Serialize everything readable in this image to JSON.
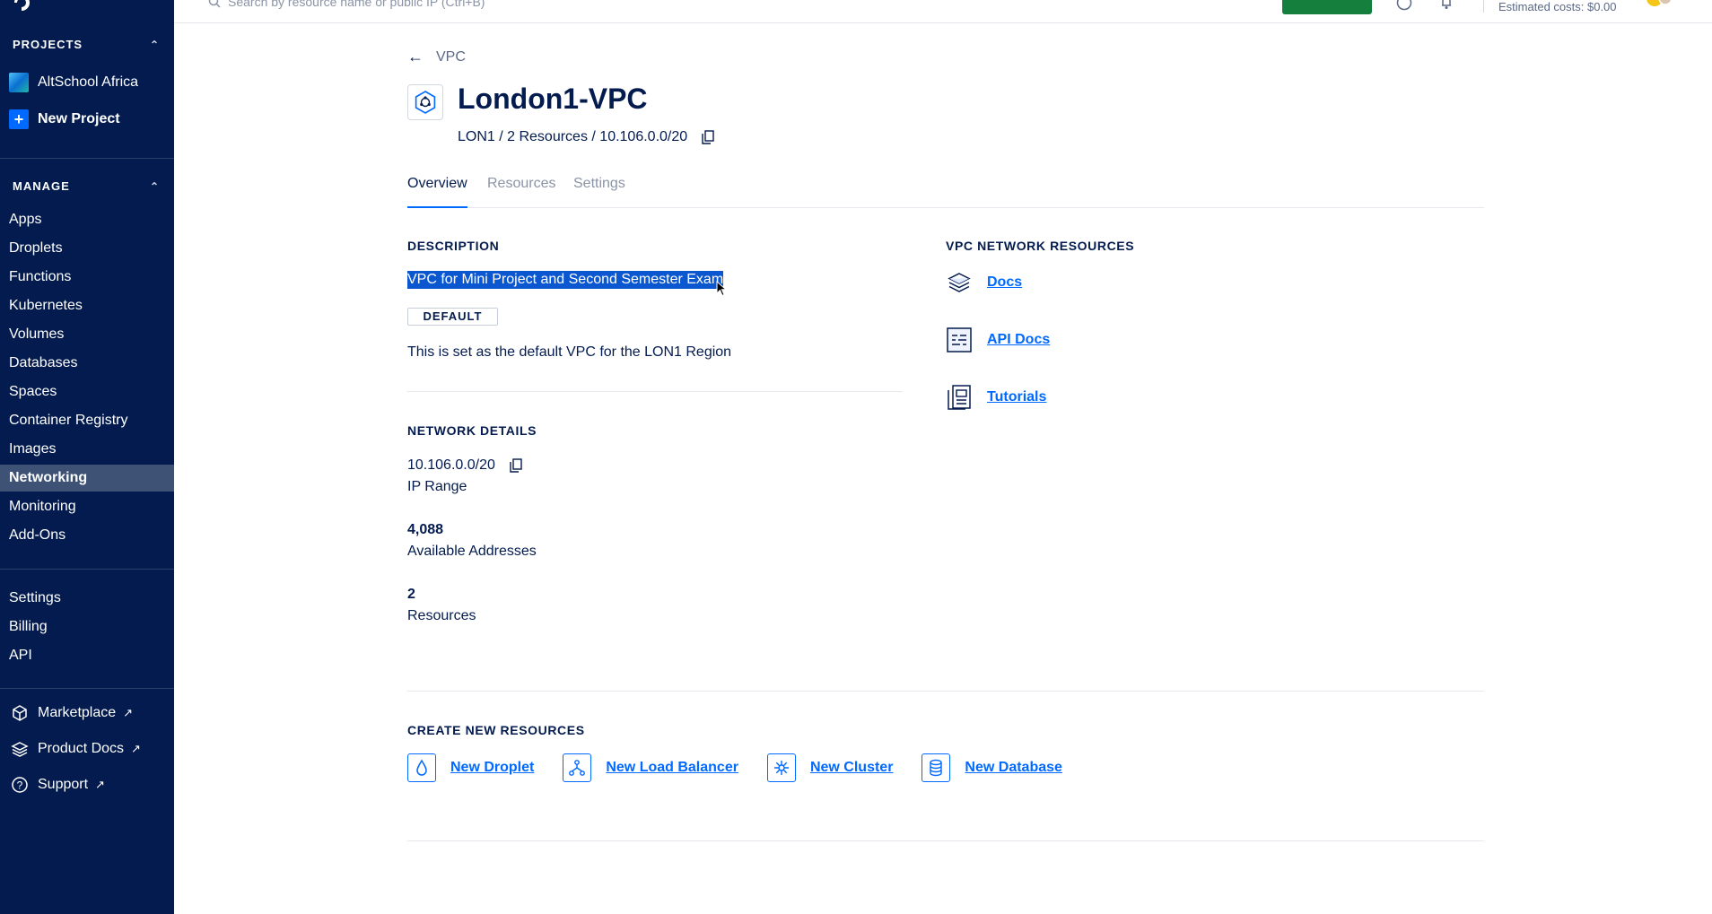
{
  "sidebar": {
    "projects_heading": "PROJECTS",
    "projects": [
      {
        "label": "AltSchool Africa",
        "icon": "project-icon"
      },
      {
        "label": "New Project",
        "icon": "plus-icon"
      }
    ],
    "manage_heading": "MANAGE",
    "nav": [
      "Apps",
      "Droplets",
      "Functions",
      "Kubernetes",
      "Volumes",
      "Databases",
      "Spaces",
      "Container Registry",
      "Images",
      "Networking",
      "Monitoring",
      "Add-Ons"
    ],
    "active_nav": "Networking",
    "account": [
      "Settings",
      "Billing",
      "API"
    ],
    "external": [
      {
        "label": "Marketplace",
        "icon": "cube-icon"
      },
      {
        "label": "Product Docs",
        "icon": "layers-icon"
      },
      {
        "label": "Support",
        "icon": "help-icon"
      }
    ]
  },
  "topbar": {
    "search_placeholder": "Search by resource name or public IP (Ctrl+B)",
    "estimated_costs": "Estimated costs: $0.00"
  },
  "header": {
    "back_label": "VPC",
    "title": "London1-VPC",
    "subtitle": "LON1 / 2 Resources / 10.106.0.0/20"
  },
  "tabs": [
    "Overview",
    "Resources",
    "Settings"
  ],
  "active_tab": "Overview",
  "description": {
    "heading": "DESCRIPTION",
    "text": "VPC for Mini Project and Second Semester Exam",
    "badge": "DEFAULT",
    "note": "This is set as the default VPC for the LON1 Region"
  },
  "network": {
    "heading": "NETWORK DETAILS",
    "ip_range_value": "10.106.0.0/20",
    "ip_range_label": "IP Range",
    "available_value": "4,088",
    "available_label": "Available Addresses",
    "resources_value": "2",
    "resources_label": "Resources"
  },
  "vpc_resources": {
    "heading": "VPC NETWORK RESOURCES",
    "links": [
      {
        "label": "Docs",
        "icon": "layers-icon"
      },
      {
        "label": "API Docs",
        "icon": "api-doc-icon"
      },
      {
        "label": "Tutorials",
        "icon": "tutorial-icon"
      }
    ]
  },
  "create": {
    "heading": "CREATE NEW RESOURCES",
    "items": [
      {
        "label": "New Droplet",
        "icon": "droplet-icon"
      },
      {
        "label": "New Load Balancer",
        "icon": "load-balancer-icon"
      },
      {
        "label": "New Cluster",
        "icon": "cluster-icon"
      },
      {
        "label": "New Database",
        "icon": "database-icon"
      }
    ]
  },
  "colors": {
    "sidebar_bg": "#031b4e",
    "accent": "#0069ff",
    "active_nav_bg": "#3d5275",
    "selection": "#0b57d0",
    "create_button": "#15803d"
  }
}
